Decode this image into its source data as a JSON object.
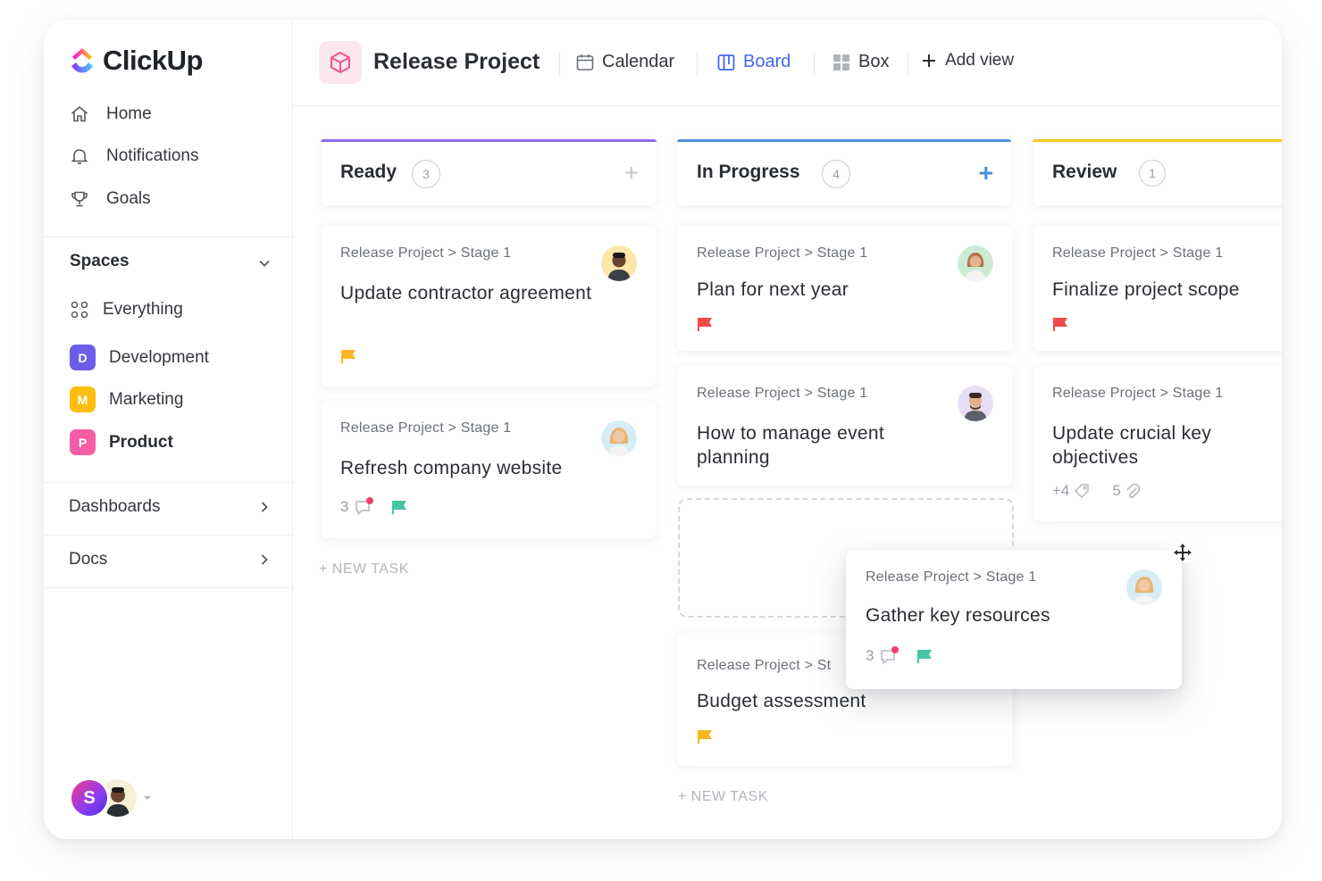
{
  "app": {
    "name": "ClickUp"
  },
  "sidebar": {
    "nav": [
      {
        "label": "Home",
        "icon": "home-icon"
      },
      {
        "label": "Notifications",
        "icon": "bell-icon"
      },
      {
        "label": "Goals",
        "icon": "trophy-icon"
      }
    ],
    "spaces_title": "Spaces",
    "spaces": [
      {
        "label": "Everything",
        "badge": "",
        "color": ""
      },
      {
        "label": "Development",
        "badge": "D",
        "color": "#6c5ce7"
      },
      {
        "label": "Marketing",
        "badge": "M",
        "color": "#fdbd0c"
      },
      {
        "label": "Product",
        "badge": "P",
        "color": "#f65da4"
      }
    ],
    "links": [
      {
        "label": "Dashboards"
      },
      {
        "label": "Docs"
      }
    ],
    "user_initial": "S"
  },
  "header": {
    "project_title": "Release Project",
    "views": [
      {
        "label": "Calendar",
        "icon": "calendar-icon",
        "active": false
      },
      {
        "label": "Board",
        "icon": "board-icon",
        "active": true
      },
      {
        "label": "Box",
        "icon": "box-grid-icon",
        "active": false
      },
      {
        "label": "Add view",
        "icon": "plus-icon",
        "active": false
      }
    ]
  },
  "board": {
    "columns": [
      {
        "name": "Ready",
        "count": "3",
        "color": "#8a6cf0"
      },
      {
        "name": "In Progress",
        "count": "4",
        "color": "#4a90e2"
      },
      {
        "name": "Review",
        "count": "1",
        "color": "#f9c829"
      }
    ],
    "breadcrumb": "Release Project > Stage 1",
    "breadcrumb_truncated": "Release Project > St",
    "cards": {
      "ready_1": {
        "title": "Update contractor agreement",
        "flag": "#fbb626"
      },
      "ready_2": {
        "title": "Refresh company website",
        "comments": "3",
        "flag": "#43c6a4"
      },
      "prog_1": {
        "title": "Plan for next year",
        "flag": "#ef4b4b"
      },
      "prog_2": {
        "title": "How to manage event planning"
      },
      "prog_3": {
        "title": "Budget assessment",
        "flag": "#fbb626"
      },
      "rev_1": {
        "title": "Finalize project scope",
        "flag": "#ef4b4b"
      },
      "rev_2": {
        "title": "Update crucial key objectives",
        "tags": "+4",
        "attachments": "5"
      },
      "drag": {
        "title": "Gather key resources",
        "comments": "3",
        "flag": "#43c6a4"
      }
    },
    "new_task_label": "+ NEW TASK"
  }
}
